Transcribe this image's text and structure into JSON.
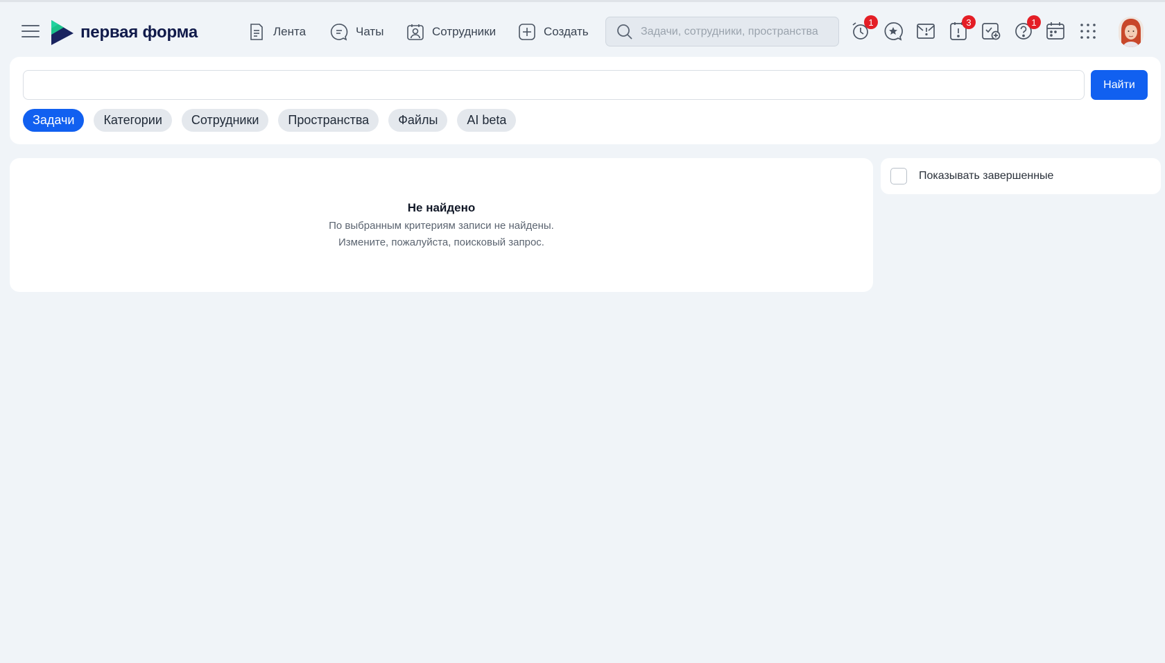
{
  "header": {
    "logo_text": "первая форма",
    "nav": [
      {
        "label": "Лента",
        "icon": "feed-icon"
      },
      {
        "label": "Чаты",
        "icon": "chat-icon"
      },
      {
        "label": "Сотрудники",
        "icon": "employees-icon"
      },
      {
        "label": "Создать",
        "icon": "plus-icon"
      }
    ],
    "search_placeholder": "Задачи, сотрудники, пространства",
    "icons": [
      {
        "name": "alarm-clock-icon",
        "badge": "1"
      },
      {
        "name": "favorites-icon",
        "badge": ""
      },
      {
        "name": "mail-icon",
        "badge": ""
      },
      {
        "name": "urgent-tasks-icon",
        "badge": "3"
      },
      {
        "name": "approvals-icon",
        "badge": ""
      },
      {
        "name": "help-icon",
        "badge": "1"
      },
      {
        "name": "calendar-icon",
        "badge": ""
      },
      {
        "name": "apps-grid-icon",
        "badge": ""
      }
    ]
  },
  "search_panel": {
    "query": "",
    "find_label": "Найти",
    "chips": [
      "Задачи",
      "Категории",
      "Сотрудники",
      "Пространства",
      "Файлы",
      "AI beta"
    ],
    "active_chip": "Задачи"
  },
  "results": {
    "title": "Не найдено",
    "line1": "По выбранным критериям записи не найдены.",
    "line2": "Измените, пожалуйста, поисковый запрос."
  },
  "filters": {
    "show_completed_label": "Показывать завершенные",
    "show_completed_checked": false
  },
  "colors": {
    "accent": "#1160f0",
    "badge": "#e41e26",
    "background": "#f0f4f8",
    "logo_text": "#101a4a"
  }
}
